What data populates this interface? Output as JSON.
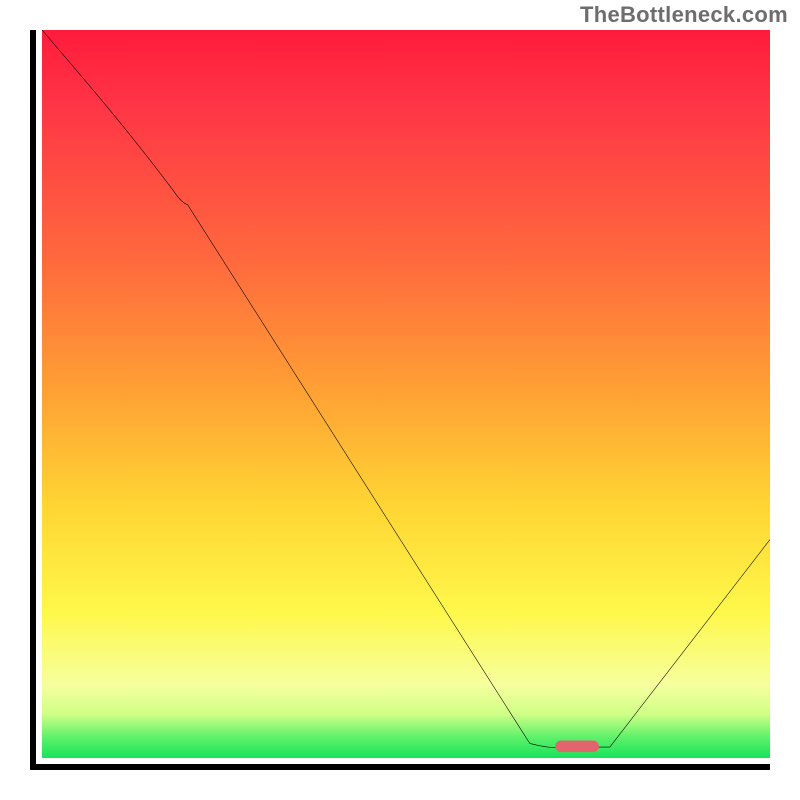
{
  "watermark": "TheBottleneck.com",
  "colors": {
    "frame": "#000000",
    "curve": "#000000",
    "marker": "#e2646c",
    "gradient_stops": [
      "#ff1b3c",
      "#ff3446",
      "#ff6a3d",
      "#ffa234",
      "#ffd433",
      "#fff84a",
      "#f6ff9e",
      "#cfff86",
      "#63f26b",
      "#16e35b"
    ]
  },
  "chart_data": {
    "type": "line",
    "title": "",
    "xlabel": "",
    "ylabel": "",
    "xlim": [
      0,
      100
    ],
    "ylim": [
      0,
      100
    ],
    "x": [
      0,
      18,
      20,
      67,
      75,
      78,
      100
    ],
    "values": [
      100,
      78,
      76,
      2,
      1.5,
      1.5,
      30
    ],
    "note": "Values estimated from pixels. High value (red) at left descending steeply, with a slight inflection ~x=19, reaching a flat trough near x≈72–78 at y≈1.5 (green band, near-zero bottleneck), then rising to ~30 at right edge.",
    "marker": {
      "shape": "rounded-bar",
      "x_center": 73.5,
      "y": 1.2,
      "width_x_units": 6,
      "color": "#e2646c"
    },
    "gradient_meaning": "Background color encodes y-value: red=high, green=low"
  }
}
